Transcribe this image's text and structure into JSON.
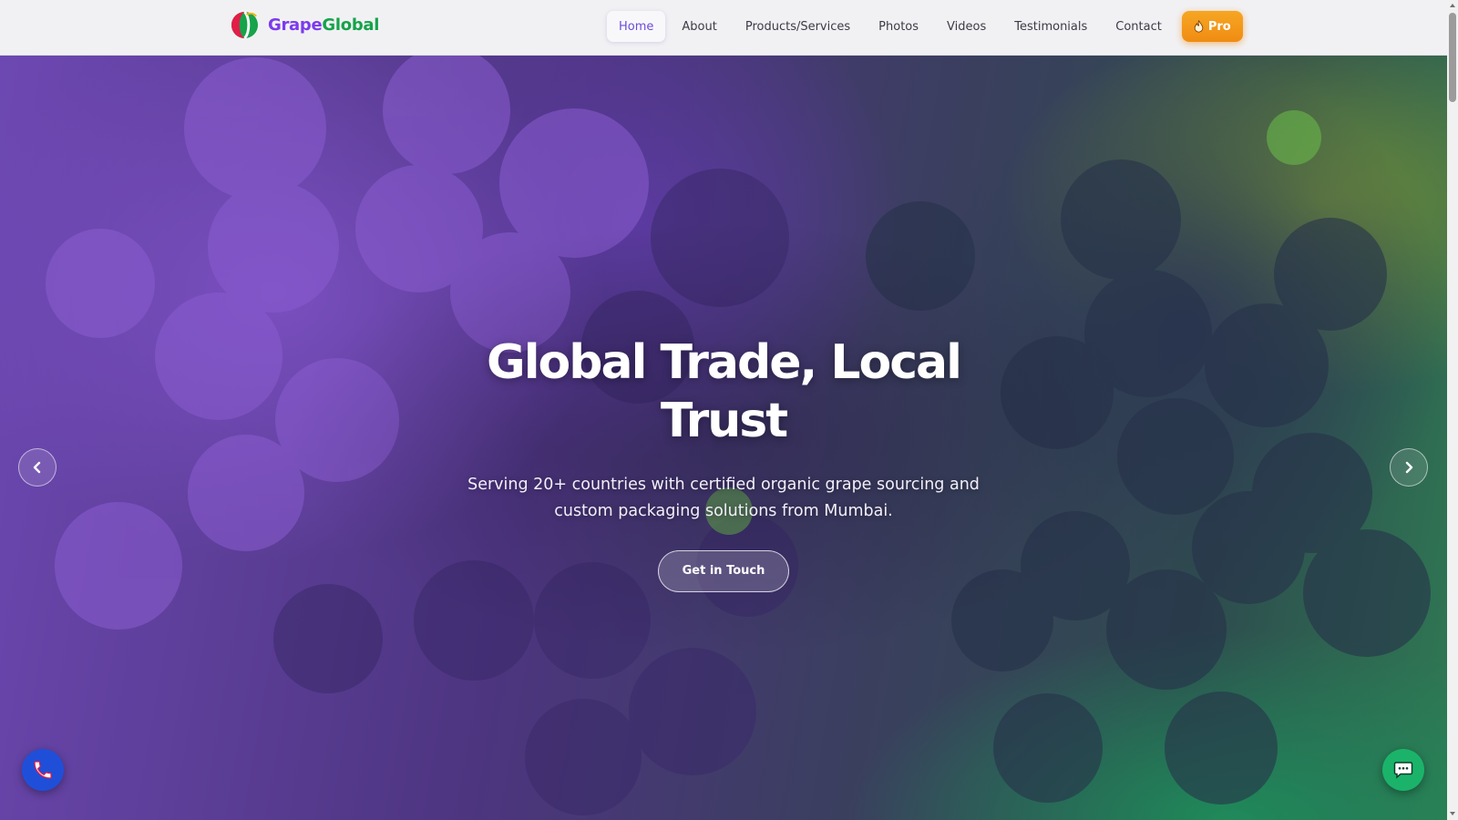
{
  "header": {
    "brand_part1": "Grape",
    "brand_part2": "Global",
    "nav": [
      {
        "label": "Home",
        "active": true
      },
      {
        "label": "About"
      },
      {
        "label": "Products/Services"
      },
      {
        "label": "Photos"
      },
      {
        "label": "Videos"
      },
      {
        "label": "Testimonials"
      },
      {
        "label": "Contact"
      }
    ],
    "pro_label": "Pro"
  },
  "hero": {
    "title_line1": "Global Trade, Local",
    "title_line2": "Trust",
    "subtitle_line1": "Serving 20+ countries with certified organic grape sourcing and",
    "subtitle_line2": "custom packaging solutions from Mumbai.",
    "cta_label": "Get in Touch"
  },
  "icons": {
    "logo": "grape-logo-icon",
    "pro": "flame-icon",
    "prev": "chevron-left-icon",
    "next": "chevron-right-icon",
    "phone": "phone-icon",
    "chat": "chat-icon"
  },
  "colors": {
    "brand_purple": "#7c3aed",
    "brand_green": "#16a34a",
    "pro_orange": "#f08c13",
    "phone_blue": "#1f4fd9",
    "chat_green": "#1bb36a"
  }
}
